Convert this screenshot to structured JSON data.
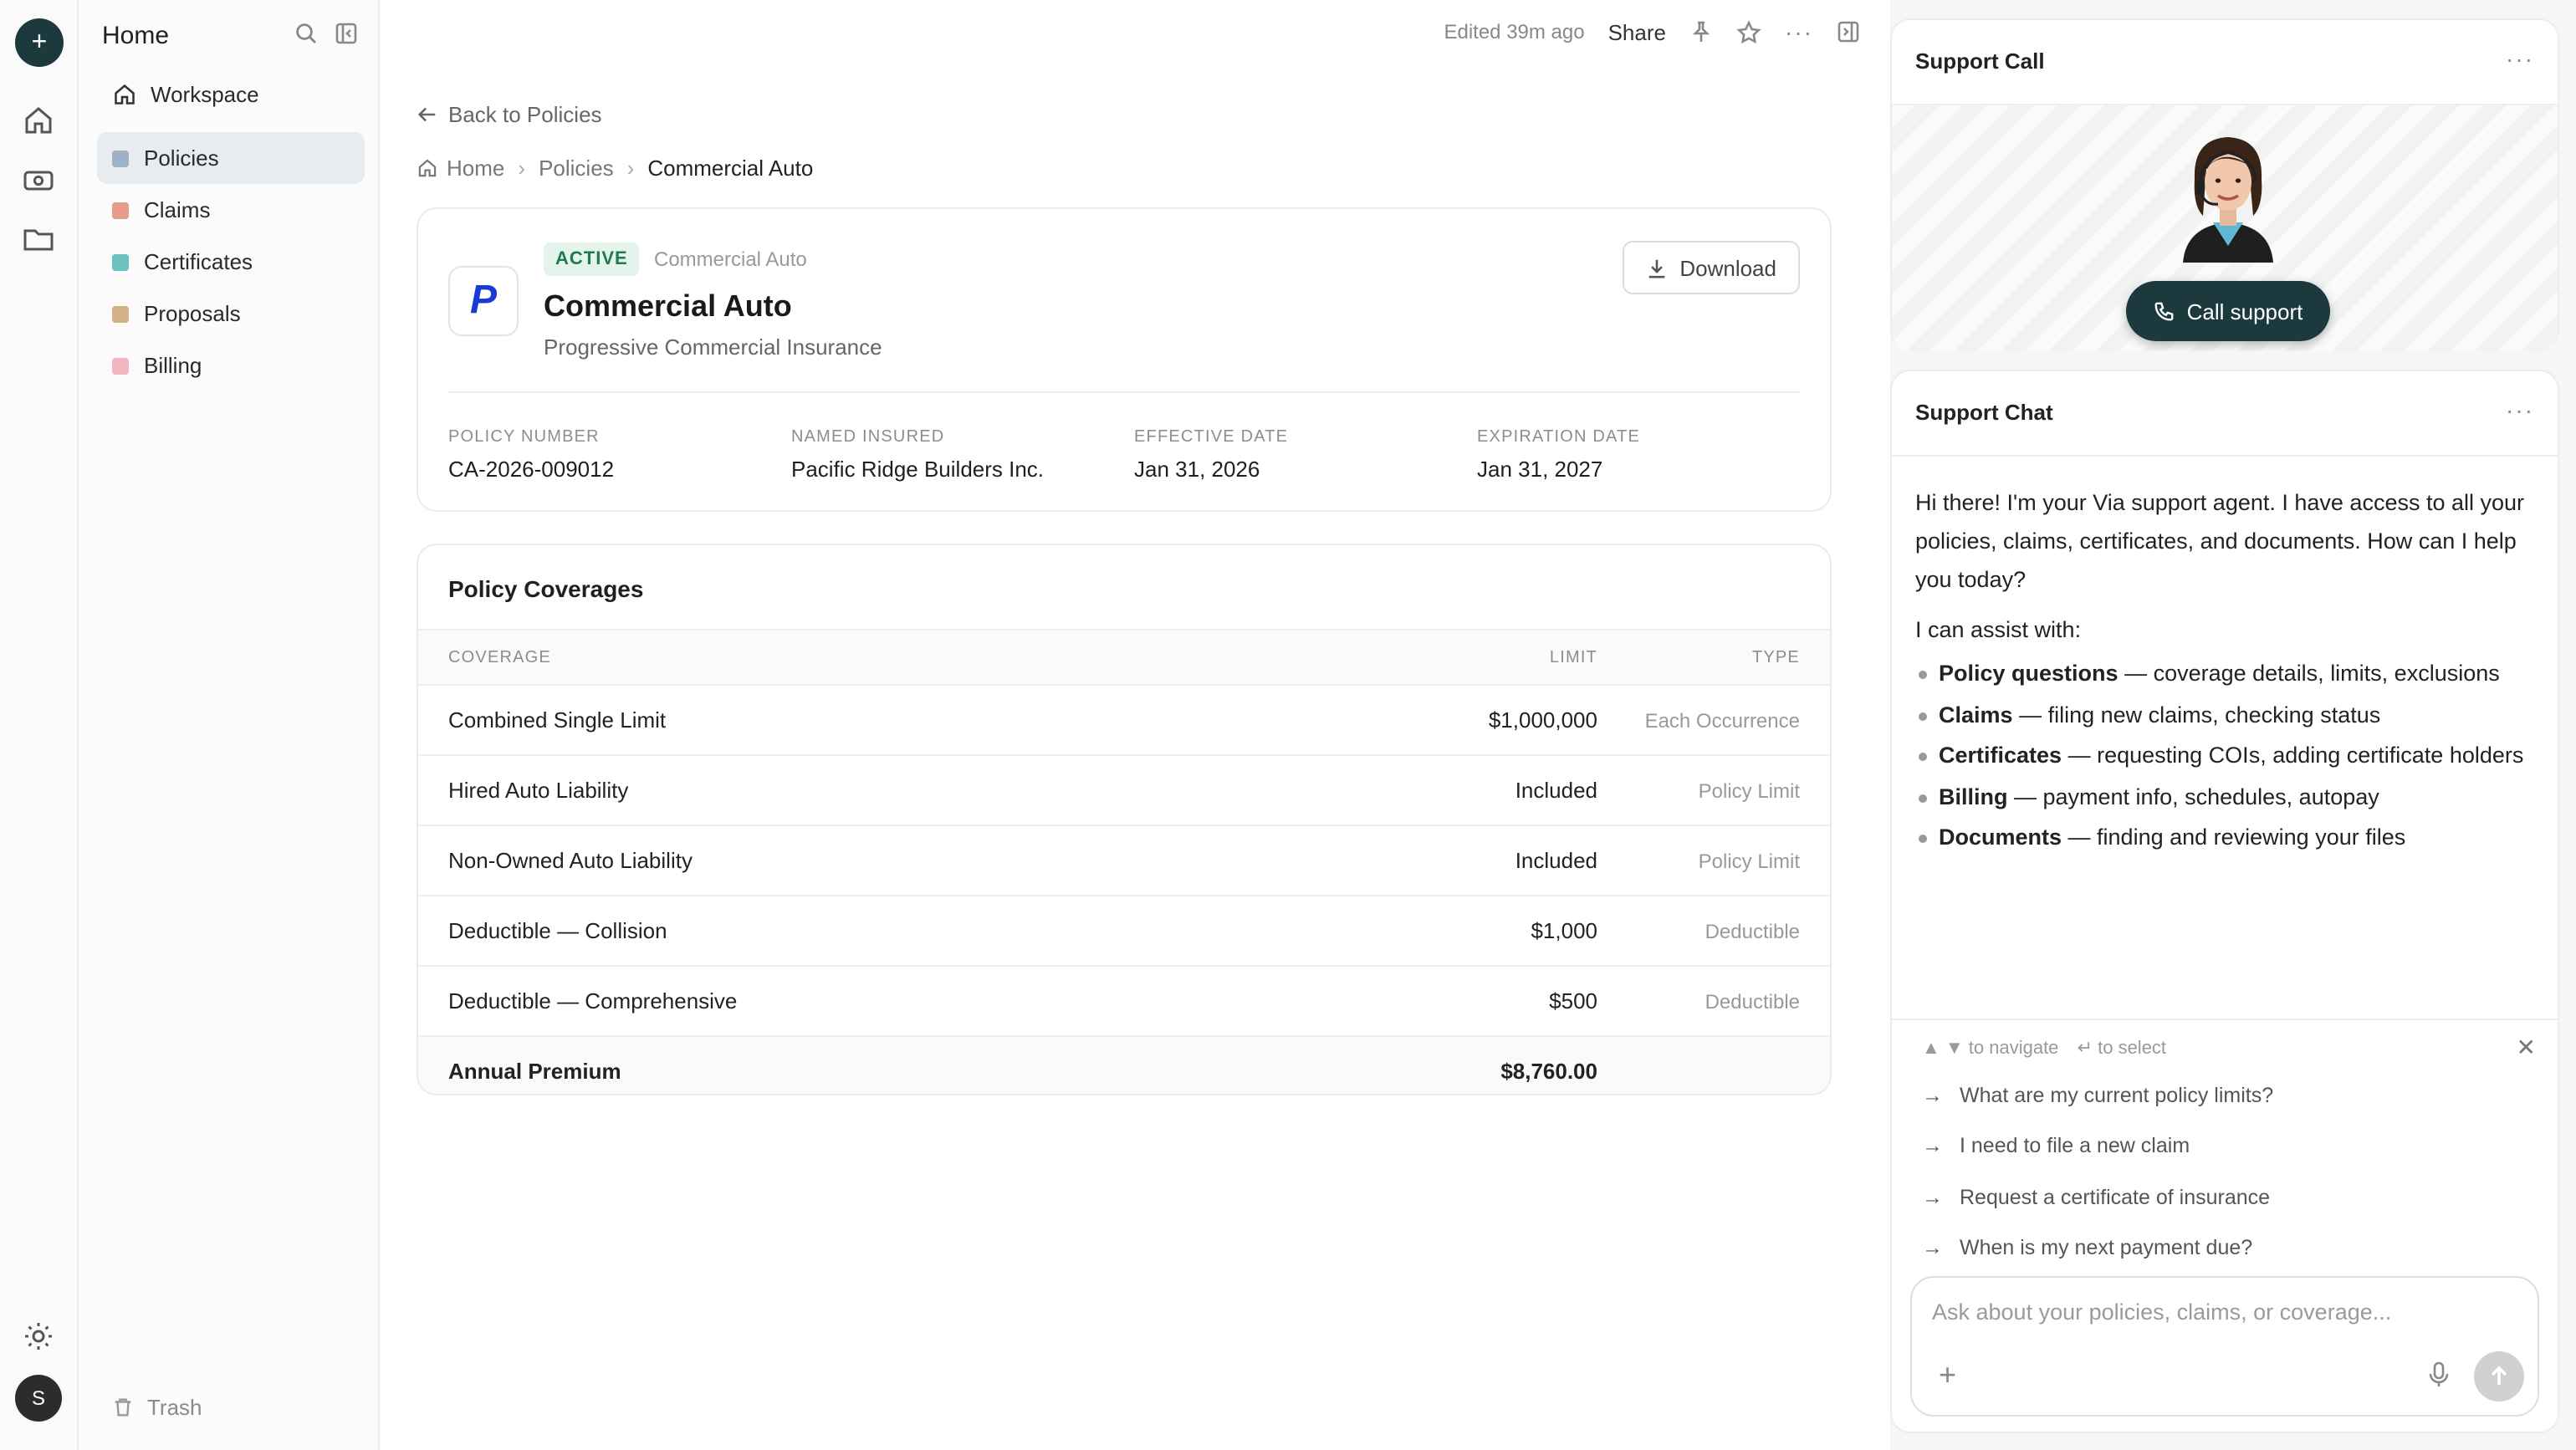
{
  "rail": {
    "new_label": "+",
    "avatar_initial": "S"
  },
  "sidebar": {
    "title": "Home",
    "workspace": "Workspace",
    "items": [
      {
        "label": "Policies",
        "color": "#9fb1c8",
        "active": true
      },
      {
        "label": "Claims",
        "color": "#e89a8a",
        "active": false
      },
      {
        "label": "Certificates",
        "color": "#6cc0bd",
        "active": false
      },
      {
        "label": "Proposals",
        "color": "#d3b085",
        "active": false
      },
      {
        "label": "Billing",
        "color": "#f0b8be",
        "active": false
      }
    ],
    "trash": "Trash"
  },
  "topbar": {
    "edited": "Edited 39m ago",
    "share": "Share"
  },
  "nav": {
    "back": "Back to Policies",
    "breadcrumb": [
      "Home",
      "Policies",
      "Commercial Auto"
    ]
  },
  "policy": {
    "status": "ACTIVE",
    "line": "Commercial Auto",
    "title": "Commercial Auto",
    "carrier": "Progressive Commercial Insurance",
    "download": "Download",
    "logo_letter": "P",
    "meta": [
      {
        "label": "POLICY NUMBER",
        "value": "CA-2026-009012"
      },
      {
        "label": "NAMED INSURED",
        "value": "Pacific Ridge Builders Inc."
      },
      {
        "label": "EFFECTIVE DATE",
        "value": "Jan 31, 2026"
      },
      {
        "label": "EXPIRATION DATE",
        "value": "Jan 31, 2027"
      }
    ]
  },
  "coverages": {
    "title": "Policy Coverages",
    "headers": {
      "coverage": "COVERAGE",
      "limit": "LIMIT",
      "type": "TYPE"
    },
    "rows": [
      {
        "coverage": "Combined Single Limit",
        "limit": "$1,000,000",
        "type": "Each Occurrence"
      },
      {
        "coverage": "Hired Auto Liability",
        "limit": "Included",
        "type": "Policy Limit"
      },
      {
        "coverage": "Non-Owned Auto Liability",
        "limit": "Included",
        "type": "Policy Limit"
      },
      {
        "coverage": "Deductible — Collision",
        "limit": "$1,000",
        "type": "Deductible"
      },
      {
        "coverage": "Deductible — Comprehensive",
        "limit": "$500",
        "type": "Deductible"
      }
    ],
    "total": {
      "label": "Annual Premium",
      "value": "$8,760.00"
    }
  },
  "support_call": {
    "title": "Support Call",
    "button": "Call support"
  },
  "support_chat": {
    "title": "Support Chat",
    "greeting": "Hi there! I'm your Via support agent. I have access to all your policies, claims, certificates, and documents. How can I help you today?",
    "assist_intro": "I can assist with:",
    "assist": [
      {
        "bold": "Policy questions",
        "rest": " — coverage details, limits, exclusions"
      },
      {
        "bold": "Claims",
        "rest": " — filing new claims, checking status"
      },
      {
        "bold": "Certificates",
        "rest": " — requesting COIs, adding certificate holders"
      },
      {
        "bold": "Billing",
        "rest": " — payment info, schedules, autopay"
      },
      {
        "bold": "Documents",
        "rest": " — finding and reviewing your files"
      }
    ],
    "hint_navigate": "▲ ▼ to navigate",
    "hint_select": "↵ to select",
    "suggestions": [
      "What are my current policy limits?",
      "I need to file a new claim",
      "Request a certificate of insurance",
      "When is my next payment due?"
    ],
    "input_placeholder": "Ask about your policies, claims, or coverage..."
  }
}
